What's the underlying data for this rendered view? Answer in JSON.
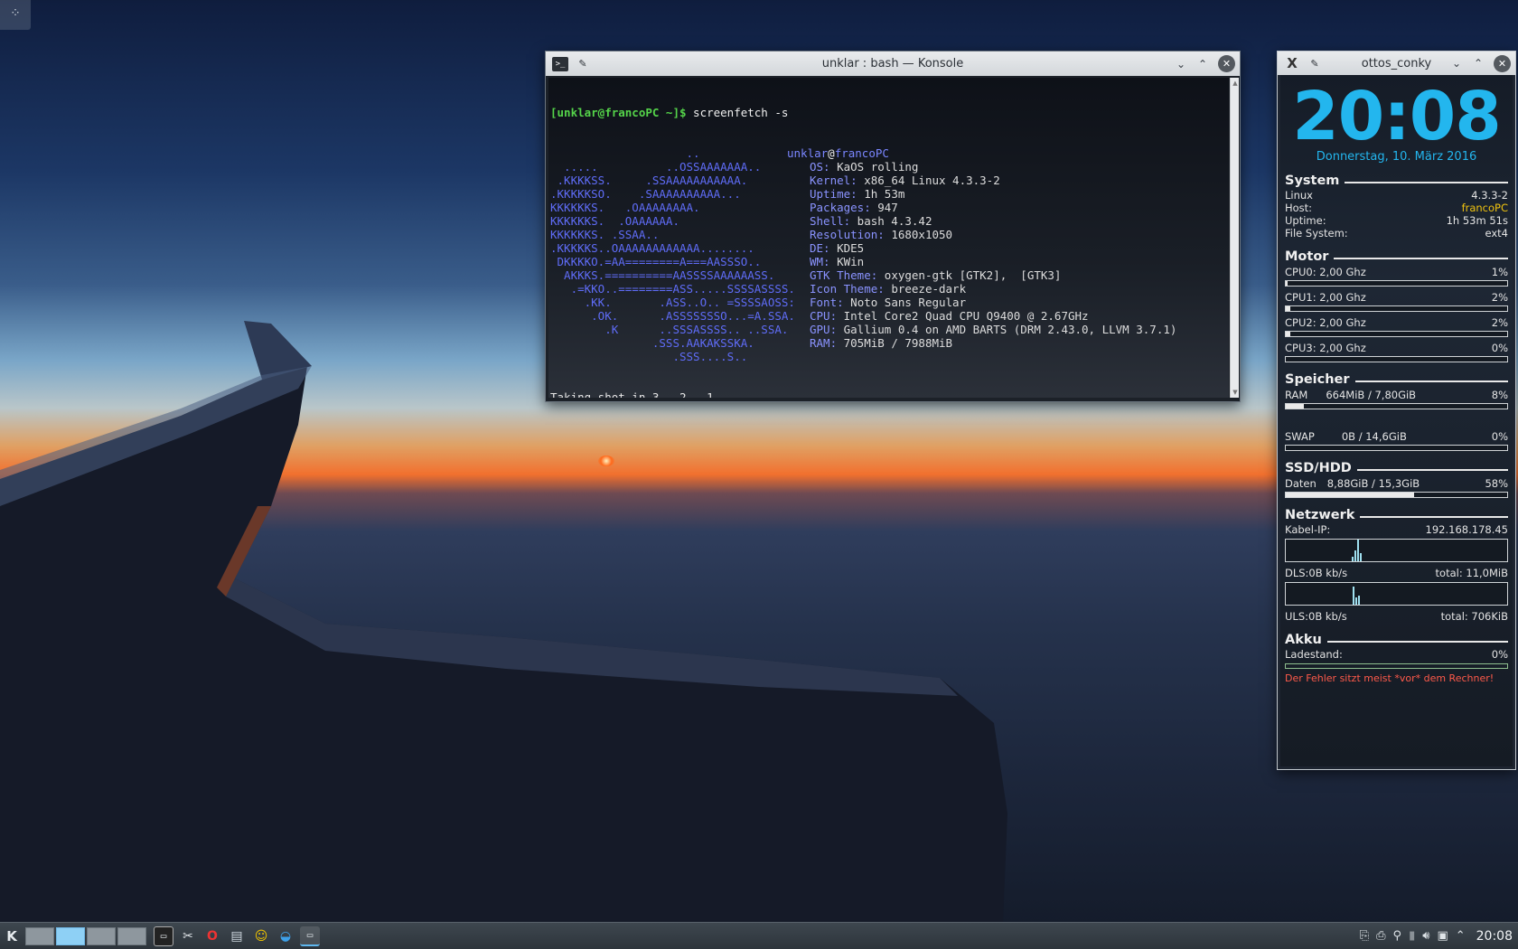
{
  "konsole": {
    "title": "unklar : bash — Konsole",
    "prompt": "[unklar@francoPC ~]$",
    "command": " screenfetch -s",
    "header_user": "unklar",
    "header_at": "@",
    "header_host": "francoPC",
    "art": [
      "                    ..              ",
      "  .....          ..OSSAAAAAAA..     ",
      " .KKKKSS.     .SSAAAAAAAAAAA.       ",
      ".KKKKKSO.    .SAAAAAAAAAA...        ",
      "KKKKKKS.   .OAAAAAAAA.              ",
      "KKKKKKS.  .OAAAAAA.                 ",
      "KKKKKKS. .SSAA..                    ",
      ".KKKKKS..OAAAAAAAAAAAA........      ",
      " DKKKKO.=AA========A===AASSSO..     ",
      "  AKKKS.==========AASSSSAAAAAASS.   ",
      "   .=KKO..========ASS.....SSSSASSSS.",
      "     .KK.       .ASS..O.. =SSSSAOSS:",
      "      .OK.      .ASSSSSSSO...=A.SSA.",
      "        .K      ..SSSASSSS.. ..SSA. ",
      "               .SSS.AAKAKSSKA.      ",
      "                  .SSS....S..       "
    ],
    "info": [
      {
        "k": "",
        "v": ""
      },
      {
        "k": "OS:",
        "v": " KaOS rolling"
      },
      {
        "k": "Kernel:",
        "v": " x86_64 Linux 4.3.3-2"
      },
      {
        "k": "Uptime:",
        "v": " 1h 53m"
      },
      {
        "k": "Packages:",
        "v": " 947"
      },
      {
        "k": "Shell:",
        "v": " bash 4.3.42"
      },
      {
        "k": "Resolution:",
        "v": " 1680x1050"
      },
      {
        "k": "DE:",
        "v": " KDE5"
      },
      {
        "k": "WM:",
        "v": " KWin"
      },
      {
        "k": "GTK Theme:",
        "v": " oxygen-gtk [GTK2],  [GTK3]"
      },
      {
        "k": "Icon Theme:",
        "v": " breeze-dark"
      },
      {
        "k": "Font:",
        "v": " Noto Sans Regular"
      },
      {
        "k": "CPU:",
        "v": " Intel Core2 Quad CPU Q9400 @ 2.67GHz"
      },
      {
        "k": "GPU:",
        "v": " Gallium 0.4 on AMD BARTS (DRM 2.43.0, LLVM 3.7.1)"
      },
      {
        "k": "RAM:",
        "v": " 705MiB / 7988MiB"
      },
      {
        "k": "",
        "v": ""
      }
    ],
    "last_line": "Taking shot in 3.. 2.. 1.."
  },
  "conky": {
    "title": "ottos_conky",
    "time": "20:08",
    "date": "Donnerstag, 10. März 2016",
    "system": {
      "heading": "System",
      "rows": [
        {
          "k": "Linux",
          "v": "4.3.3-2"
        },
        {
          "k": "Host:",
          "v": "francoPC"
        },
        {
          "k": "Uptime:",
          "v": "1h 53m 51s"
        },
        {
          "k": "File System:",
          "v": "ext4"
        }
      ]
    },
    "motor": {
      "heading": "Motor",
      "cpus": [
        {
          "label": "CPU0: 2,00 Ghz",
          "pct": "1%",
          "frac": 0.01
        },
        {
          "label": "CPU1: 2,00 Ghz",
          "pct": "2%",
          "frac": 0.02
        },
        {
          "label": "CPU2: 2,00 Ghz",
          "pct": "2%",
          "frac": 0.02
        },
        {
          "label": "CPU3: 2,00 Ghz",
          "pct": "0%",
          "frac": 0.0
        }
      ]
    },
    "speicher": {
      "heading": "Speicher",
      "ram_label": "RAM",
      "ram_value": "664MiB / 7,80GiB",
      "ram_pct": "8%",
      "ram_frac": 0.08,
      "swap_label": "SWAP",
      "swap_value": "0B   / 14,6GiB",
      "swap_pct": "0%",
      "swap_frac": 0.0
    },
    "disk": {
      "heading": "SSD/HDD",
      "label": "Daten",
      "value": "8,88GiB / 15,3GiB",
      "pct": "58%",
      "frac": 0.58
    },
    "net": {
      "heading": "Netzwerk",
      "ip_label": "Kabel-IP:",
      "ip": "192.168.178.45",
      "dl_label": "DLS:0B   kb/s",
      "dl_total": "total: 11,0MiB",
      "ul_label": "ULS:0B   kb/s",
      "ul_total": "total: 706KiB"
    },
    "akku": {
      "heading": "Akku",
      "label": "Ladestand:",
      "pct": "0%"
    },
    "motto": "Der Fehler sitzt meist  *vor*  dem Rechner!"
  },
  "taskbar": {
    "clock": "20:08",
    "launcher": "K"
  },
  "icons": {
    "konsole_icon": ">_",
    "pin": "✎",
    "minimize": "⌄",
    "maximize": "⌃",
    "close": "✕"
  },
  "colors": {
    "accent": "#23b6ee",
    "host_yellow": "#f1c40f",
    "prompt_green": "#55d44a",
    "art_blue": "#5f6cf7"
  }
}
